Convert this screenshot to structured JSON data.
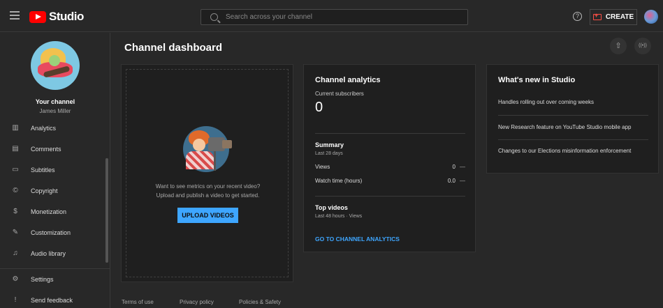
{
  "header": {
    "logo_text": "Studio",
    "search_placeholder": "Search across your channel",
    "help_glyph": "?",
    "create_label": "CREATE"
  },
  "sidebar": {
    "channel_title": "Your channel",
    "channel_name": "James Miller",
    "items": [
      {
        "label": "Analytics",
        "icon": "analytics-icon",
        "glyph": "▥"
      },
      {
        "label": "Comments",
        "icon": "comments-icon",
        "glyph": "▤"
      },
      {
        "label": "Subtitles",
        "icon": "subtitles-icon",
        "glyph": "▭"
      },
      {
        "label": "Copyright",
        "icon": "copyright-icon",
        "glyph": "©"
      },
      {
        "label": "Monetization",
        "icon": "monetization-icon",
        "glyph": "$"
      },
      {
        "label": "Customization",
        "icon": "customization-icon",
        "glyph": "✎"
      },
      {
        "label": "Audio library",
        "icon": "audio-library-icon",
        "glyph": "♫"
      }
    ],
    "bottom_items": [
      {
        "label": "Settings",
        "icon": "settings-icon",
        "glyph": "⚙"
      },
      {
        "label": "Send feedback",
        "icon": "feedback-icon",
        "glyph": "!"
      }
    ]
  },
  "main": {
    "title": "Channel dashboard",
    "upload_glyph": "⇧",
    "live_glyph": "((•))",
    "empty_card": {
      "line1": "Want to see metrics on your recent video?",
      "line2": "Upload and publish a video to get started.",
      "button": "UPLOAD VIDEOS"
    },
    "analytics": {
      "title": "Channel analytics",
      "subscribers_label": "Current subscribers",
      "subscribers_count": "0",
      "summary_title": "Summary",
      "summary_period": "Last 28 days",
      "rows": [
        {
          "label": "Views",
          "value": "0",
          "trend": "—"
        },
        {
          "label": "Watch time (hours)",
          "value": "0.0",
          "trend": "—"
        }
      ],
      "top_videos_title": "Top videos",
      "top_videos_period": "Last 48 hours · Views",
      "link": "GO TO CHANNEL ANALYTICS"
    },
    "news": {
      "title": "What's new in Studio",
      "items": [
        "Handles rolling out over coming weeks",
        "New Research feature on YouTube Studio mobile app",
        "Changes to our Elections misinformation enforcement"
      ]
    }
  },
  "footer": {
    "links": [
      "Terms of use",
      "Privacy policy",
      "Policies & Safety"
    ]
  },
  "colors": {
    "accent": "#3ea6ff",
    "brand": "#ff0000",
    "background": "#282828",
    "card": "#1f1f1f"
  }
}
